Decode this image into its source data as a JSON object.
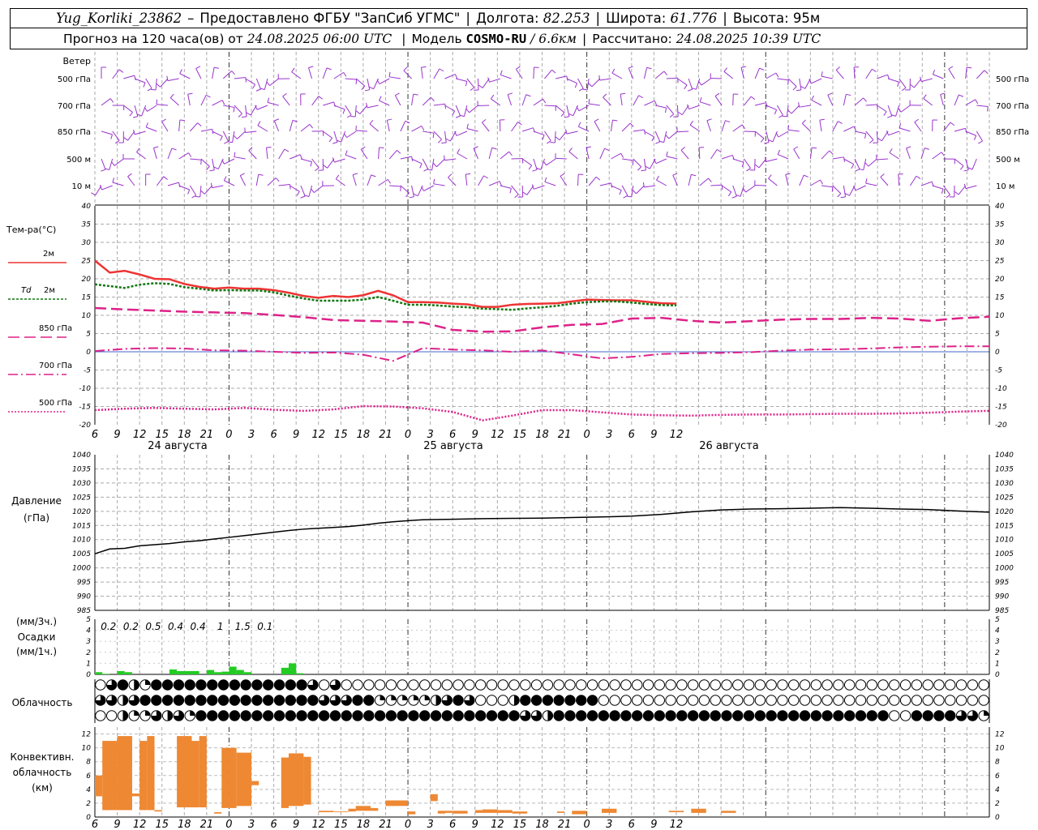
{
  "header": {
    "station": "Yug_Korliki_23862",
    "dash": "–",
    "provider": "Предоставлено ФГБУ \"ЗапСиб УГМС\"",
    "lon_label": "Долгота:",
    "lon": "82.253",
    "lat_label": "Широта:",
    "lat": "61.776",
    "alt_label": "Высота:",
    "alt": "95м",
    "forecast_label": "Прогноз на 120 часа(ов) от",
    "forecast_from": "24.08.2025 06:00 UTC",
    "model_label": "Модель",
    "model": "COSMO-RU",
    "model_res": "/ 6.6км",
    "calc_label": "Рассчитано:",
    "calc_time": "24.08.2025 10:39 UTC"
  },
  "labels": {
    "wind": "Ветер",
    "wind_levels": [
      "500 гПа",
      "700 гПа",
      "850 гПа",
      "500 м",
      "10  м"
    ],
    "temp_title": "Тем-ра(°C)",
    "t2m": "2м",
    "td_prefix": "Td",
    "td2m": "2м",
    "t850": "850 гПа",
    "t700": "700 гПа",
    "t500": "500 гПа",
    "pressure": "Давление",
    "pressure_unit": "(гПа)",
    "precip_unit1": "(мм/3ч.)",
    "precip_title": "Осадки",
    "precip_unit2": "(мм/1ч.)",
    "clouds": "Облачность",
    "conv1": "Конвективн.",
    "conv2": "облачность",
    "conv3": "(км)"
  },
  "time_axis": {
    "hour_ticks": [
      "6",
      "9",
      "12",
      "15",
      "18",
      "21",
      "0",
      "3",
      "6",
      "9",
      "12",
      "15",
      "18",
      "21",
      "0",
      "3",
      "6",
      "9",
      "12",
      "15",
      "18",
      "21",
      "0",
      "3",
      "6",
      "9",
      "12"
    ],
    "dates": [
      "24 августа",
      "25 августа",
      "26 августа"
    ]
  },
  "colors": {
    "wind": "#9933cc",
    "t2m": "#ee3333",
    "td2m": "#117711",
    "tlevels": "#dd2288",
    "pressure": "#000000",
    "precip": "#22cc22",
    "convective": "#ee8833"
  },
  "chart_data": [
    {
      "type": "line",
      "title": "Тем-ра(°C)",
      "x_unit": "hours from 24.08.2025 06:00 UTC",
      "ylim": [
        -20,
        40
      ],
      "yticks": [
        "40",
        "35",
        "30",
        "25",
        "20",
        "15",
        "10",
        "5",
        "0",
        "-5",
        "-10",
        "-15",
        "-20"
      ],
      "series": [
        {
          "name": "2м",
          "x": [
            0,
            2,
            4,
            6,
            8,
            10,
            12,
            14,
            16,
            18,
            20,
            22,
            24,
            26,
            28,
            30,
            32,
            34,
            36,
            38,
            40,
            42,
            44,
            46,
            48,
            50,
            52,
            54,
            56,
            58,
            60,
            62,
            64,
            66,
            68,
            70,
            72,
            74,
            76,
            78
          ],
          "values": [
            25,
            21.7,
            22.2,
            21.2,
            20,
            19.9,
            18.6,
            17.8,
            17.3,
            17.6,
            17.3,
            17.3,
            16.9,
            16.2,
            15.3,
            14.8,
            15.3,
            15.0,
            15.5,
            16.7,
            15.5,
            13.6,
            13.6,
            13.5,
            13.2,
            13.0,
            12.3,
            12.3,
            12.9,
            13.1,
            13.2,
            13.3,
            13.8,
            14.3,
            14.2,
            14.1,
            14.1,
            13.7,
            13.3,
            13.2
          ]
        },
        {
          "name": "Td 2м",
          "x": [
            0,
            2,
            4,
            6,
            8,
            10,
            12,
            14,
            16,
            18,
            20,
            22,
            24,
            26,
            28,
            30,
            32,
            34,
            36,
            38,
            40,
            42,
            44,
            46,
            48,
            50,
            52,
            54,
            56,
            58,
            60,
            62,
            64,
            66,
            68,
            70,
            72,
            74,
            76,
            78
          ],
          "values": [
            18.5,
            18.0,
            17.5,
            18.4,
            18.8,
            18.6,
            17.7,
            17.3,
            16.8,
            16.9,
            16.8,
            16.8,
            16.3,
            15.4,
            14.6,
            14.0,
            14.0,
            14.0,
            14.3,
            15.0,
            14.0,
            12.9,
            12.9,
            12.7,
            12.4,
            12.2,
            11.8,
            11.7,
            11.5,
            11.9,
            12.2,
            12.6,
            13.2,
            13.6,
            13.8,
            13.8,
            13.5,
            13.1,
            12.8,
            12.7
          ]
        },
        {
          "name": "850 гПа",
          "x": [
            0,
            4,
            8,
            12,
            16,
            20,
            24,
            28,
            32,
            36,
            40,
            44,
            48,
            52,
            56,
            60,
            64,
            68,
            72,
            76,
            80,
            84,
            88,
            92,
            96,
            100,
            104,
            108,
            112,
            116,
            120
          ],
          "values": [
            12.0,
            11.6,
            11.3,
            11.0,
            10.8,
            10.6,
            10.1,
            9.5,
            8.7,
            8.5,
            8.3,
            8.0,
            6.0,
            5.5,
            5.6,
            6.7,
            7.4,
            7.6,
            9.1,
            9.3,
            8.5,
            8.0,
            8.4,
            8.8,
            9.0,
            9.0,
            9.3,
            9.1,
            8.5,
            9.2,
            9.6
          ]
        },
        {
          "name": "700 гПа",
          "x": [
            0,
            4,
            8,
            12,
            16,
            20,
            24,
            28,
            32,
            36,
            40,
            44,
            48,
            52,
            56,
            60,
            64,
            68,
            72,
            76,
            80,
            84,
            88,
            92,
            96,
            100,
            104,
            108,
            112,
            116,
            120
          ],
          "values": [
            0.2,
            0.8,
            1.0,
            0.9,
            0.4,
            0.3,
            0.0,
            -0.3,
            -0.2,
            -0.8,
            -2.5,
            1.0,
            0.6,
            0.4,
            0.0,
            0.4,
            -0.7,
            -1.8,
            -1.4,
            -0.6,
            -0.4,
            -0.3,
            -0.1,
            0.3,
            0.6,
            0.7,
            0.9,
            1.2,
            1.4,
            1.5,
            1.5
          ]
        },
        {
          "name": "500 гПа",
          "x": [
            0,
            4,
            8,
            12,
            16,
            20,
            24,
            28,
            32,
            36,
            40,
            44,
            48,
            52,
            56,
            60,
            64,
            68,
            72,
            76,
            80,
            84,
            88,
            92,
            96,
            100,
            104,
            108,
            112,
            116,
            120
          ],
          "values": [
            -16,
            -15.6,
            -15.4,
            -15.6,
            -15.8,
            -15.4,
            -15.9,
            -16.2,
            -15.8,
            -14.9,
            -15.0,
            -15.5,
            -16.5,
            -18.8,
            -17.5,
            -16.0,
            -16.0,
            -16.6,
            -17.2,
            -17.4,
            -17.5,
            -17.3,
            -17.2,
            -17.2,
            -17.1,
            -17.0,
            -17.0,
            -16.9,
            -16.7,
            -16.4,
            -16.2
          ]
        }
      ]
    },
    {
      "type": "line",
      "title": "Давление",
      "ylabel": "(гПа)",
      "x_unit": "hours from 24.08.2025 06:00 UTC",
      "ylim": [
        985,
        1040
      ],
      "yticks": [
        "1040",
        "1035",
        "1030",
        "1025",
        "1020",
        "1015",
        "1010",
        "1005",
        "1000",
        "995",
        "990",
        "985"
      ],
      "series": [
        {
          "name": "",
          "x": [
            0,
            2,
            4,
            6,
            8,
            10,
            12,
            14,
            16,
            18,
            20,
            22,
            24,
            26,
            28,
            30,
            32,
            34,
            36,
            38,
            40,
            42,
            44,
            48,
            52,
            56,
            60,
            64,
            68,
            72,
            76,
            80,
            84,
            88,
            92,
            96,
            100,
            104,
            108,
            112,
            116,
            120
          ],
          "values": [
            1005,
            1006.7,
            1006.9,
            1007.8,
            1008.2,
            1008.6,
            1009.2,
            1009.6,
            1010.2,
            1010.8,
            1011.4,
            1012,
            1012.6,
            1013.2,
            1013.7,
            1014,
            1014.3,
            1014.6,
            1015.1,
            1015.8,
            1016.3,
            1016.7,
            1017,
            1017.2,
            1017.4,
            1017.5,
            1017.6,
            1017.8,
            1018.0,
            1018.3,
            1018.9,
            1019.8,
            1020.5,
            1020.8,
            1020.9,
            1021.1,
            1021.3,
            1021.1,
            1020.8,
            1020.6,
            1020.1,
            1019.7
          ]
        }
      ]
    },
    {
      "type": "bar",
      "title": "Осадки",
      "ylabel": "(мм/1ч.)",
      "x_unit": "hour index from 24.08.2025 06:00 UTC",
      "ylim": [
        0,
        5
      ],
      "yticks": [
        "5",
        "4",
        "3",
        "2",
        "1",
        "0"
      ],
      "x": [
        0,
        1,
        2,
        3,
        4,
        5,
        6,
        7,
        8,
        9,
        10,
        11,
        12,
        13,
        14,
        15,
        16,
        17,
        18,
        19,
        20,
        21,
        22,
        23,
        24,
        25,
        26,
        27,
        28,
        29,
        30,
        31,
        32,
        33,
        34,
        35,
        36
      ],
      "values": [
        0.2,
        0.05,
        0.0,
        0.3,
        0.2,
        0.0,
        0.0,
        0.0,
        0.0,
        0.0,
        0.45,
        0.3,
        0.3,
        0.3,
        0.0,
        0.4,
        0.2,
        0.25,
        0.7,
        0.4,
        0.2,
        0.0,
        0.0,
        0.0,
        0.0,
        0.6,
        1.0,
        0.1,
        0.0,
        0.0,
        0.0,
        0.0,
        0.0,
        0.0,
        0.0,
        0.0,
        0.0
      ],
      "three_hour_labels": [
        "0.2",
        "0.2",
        "0.5",
        "0.4",
        "0.4",
        "1",
        "1.5",
        "0.1"
      ]
    },
    {
      "type": "table",
      "title": "Облачность",
      "x_unit": "hour index from 24.08.2025 06:00 UTC (step 2h, 0..240)",
      "note": "cloud cover symbols: 0 clear, 1 quarter, 2 half, 3 three-quarter, 4 overcast",
      "rows": [
        [
          0,
          3,
          4,
          2,
          1,
          4,
          4,
          4,
          4,
          4,
          4,
          4,
          4,
          4,
          4,
          4,
          4,
          4,
          4,
          3,
          0,
          3,
          0,
          0,
          0,
          0,
          0,
          0,
          0,
          0,
          0,
          0,
          0,
          0,
          0,
          0,
          0,
          0,
          0,
          0,
          0,
          0,
          0,
          0,
          0,
          0,
          0,
          0,
          0,
          0,
          0,
          0,
          0,
          0,
          0,
          0,
          0,
          0,
          0,
          0,
          0,
          0,
          0,
          0,
          0,
          0,
          0,
          0,
          0,
          0,
          0,
          0,
          0,
          0,
          0,
          0,
          0,
          0,
          0,
          0
        ],
        [
          3,
          3,
          2,
          3,
          4,
          4,
          4,
          4,
          4,
          4,
          4,
          4,
          4,
          4,
          4,
          4,
          4,
          4,
          4,
          4,
          3,
          3,
          3,
          4,
          4,
          1,
          1,
          1,
          1,
          1,
          2,
          3,
          4,
          3,
          0,
          0,
          0,
          2,
          4,
          4,
          4,
          4,
          4,
          4,
          4,
          0,
          0,
          0,
          0,
          0,
          0,
          0,
          0,
          0,
          0,
          0,
          0,
          0,
          0,
          0,
          0,
          0,
          0,
          0,
          0,
          0,
          0,
          0,
          0,
          0,
          0,
          0,
          0,
          0,
          0,
          0,
          0,
          0,
          0,
          0
        ],
        [
          0,
          0,
          2,
          1,
          1,
          3,
          2,
          3,
          1,
          4,
          4,
          4,
          4,
          4,
          4,
          4,
          4,
          4,
          4,
          4,
          4,
          4,
          4,
          4,
          4,
          4,
          4,
          4,
          4,
          4,
          4,
          4,
          4,
          4,
          4,
          4,
          4,
          4,
          3,
          3,
          2,
          4,
          4,
          4,
          4,
          4,
          4,
          4,
          4,
          4,
          4,
          4,
          4,
          4,
          4,
          4,
          4,
          4,
          4,
          4,
          4,
          4,
          4,
          4,
          4,
          4,
          4,
          4,
          4,
          4,
          4,
          0,
          0,
          4,
          4,
          4,
          4,
          3,
          3,
          1
        ]
      ]
    },
    {
      "type": "bar",
      "title": "Конвективн. облачность",
      "ylabel": "(км)",
      "x_unit": "hour index from 24.08.2025 06:00 UTC",
      "ylim": [
        0,
        13
      ],
      "yticks": [
        "12",
        "10",
        "8",
        "6",
        "4",
        "2",
        "0"
      ],
      "bars": [
        {
          "x0": 0,
          "x1": 1,
          "base": 3.0,
          "top": 6.0
        },
        {
          "x0": 1,
          "x1": 3,
          "base": 1.0,
          "top": 11.0
        },
        {
          "x0": 3,
          "x1": 5,
          "base": 1.0,
          "top": 11.7
        },
        {
          "x0": 5,
          "x1": 6,
          "base": 3.0,
          "top": 3.4
        },
        {
          "x0": 6,
          "x1": 7,
          "base": 1.0,
          "top": 11.0
        },
        {
          "x0": 7,
          "x1": 8,
          "base": 1.0,
          "top": 11.7
        },
        {
          "x0": 8,
          "x1": 9,
          "base": 0.8,
          "top": 1.0
        },
        {
          "x0": 11,
          "x1": 13,
          "base": 1.4,
          "top": 11.7
        },
        {
          "x0": 13,
          "x1": 14,
          "base": 1.4,
          "top": 11.0
        },
        {
          "x0": 14,
          "x1": 15,
          "base": 1.4,
          "top": 11.7
        },
        {
          "x0": 16,
          "x1": 17,
          "base": 0.5,
          "top": 0.7
        },
        {
          "x0": 17,
          "x1": 18,
          "base": 1.3,
          "top": 10.0
        },
        {
          "x0": 18,
          "x1": 19,
          "base": 1.3,
          "top": 10.0
        },
        {
          "x0": 19,
          "x1": 21,
          "base": 1.6,
          "top": 9.3
        },
        {
          "x0": 21,
          "x1": 22,
          "base": 4.6,
          "top": 5.2
        },
        {
          "x0": 25,
          "x1": 26,
          "base": 1.3,
          "top": 8.6
        },
        {
          "x0": 26,
          "x1": 28,
          "base": 1.6,
          "top": 9.2
        },
        {
          "x0": 28,
          "x1": 29,
          "base": 1.8,
          "top": 8.7
        },
        {
          "x0": 30,
          "x1": 32,
          "base": 0.7,
          "top": 0.9
        },
        {
          "x0": 32,
          "x1": 34,
          "base": 0.7,
          "top": 0.8
        },
        {
          "x0": 34,
          "x1": 35,
          "base": 0.8,
          "top": 1.2
        },
        {
          "x0": 35,
          "x1": 37,
          "base": 0.9,
          "top": 1.6
        },
        {
          "x0": 37,
          "x1": 38,
          "base": 0.9,
          "top": 1.3
        },
        {
          "x0": 39,
          "x1": 42,
          "base": 1.6,
          "top": 2.4
        },
        {
          "x0": 42,
          "x1": 43,
          "base": 0.4,
          "top": 0.8
        },
        {
          "x0": 45,
          "x1": 46,
          "base": 2.3,
          "top": 3.3
        },
        {
          "x0": 46,
          "x1": 47,
          "base": 0.5,
          "top": 0.9
        },
        {
          "x0": 47,
          "x1": 48,
          "base": 0.6,
          "top": 0.9
        },
        {
          "x0": 48,
          "x1": 50,
          "base": 0.5,
          "top": 0.9
        },
        {
          "x0": 51,
          "x1": 52,
          "base": 0.6,
          "top": 1.0
        },
        {
          "x0": 52,
          "x1": 54,
          "base": 0.6,
          "top": 1.1
        },
        {
          "x0": 54,
          "x1": 56,
          "base": 0.6,
          "top": 1.0
        },
        {
          "x0": 56,
          "x1": 58,
          "base": 0.5,
          "top": 0.8
        },
        {
          "x0": 62,
          "x1": 63,
          "base": 0.6,
          "top": 0.8
        },
        {
          "x0": 64,
          "x1": 66,
          "base": 0.4,
          "top": 0.9
        },
        {
          "x0": 68,
          "x1": 70,
          "base": 0.6,
          "top": 1.2
        },
        {
          "x0": 77,
          "x1": 79,
          "base": 0.7,
          "top": 0.9
        },
        {
          "x0": 80,
          "x1": 82,
          "base": 0.6,
          "top": 1.2
        },
        {
          "x0": 84,
          "x1": 86,
          "base": 0.6,
          "top": 0.9
        }
      ]
    }
  ]
}
